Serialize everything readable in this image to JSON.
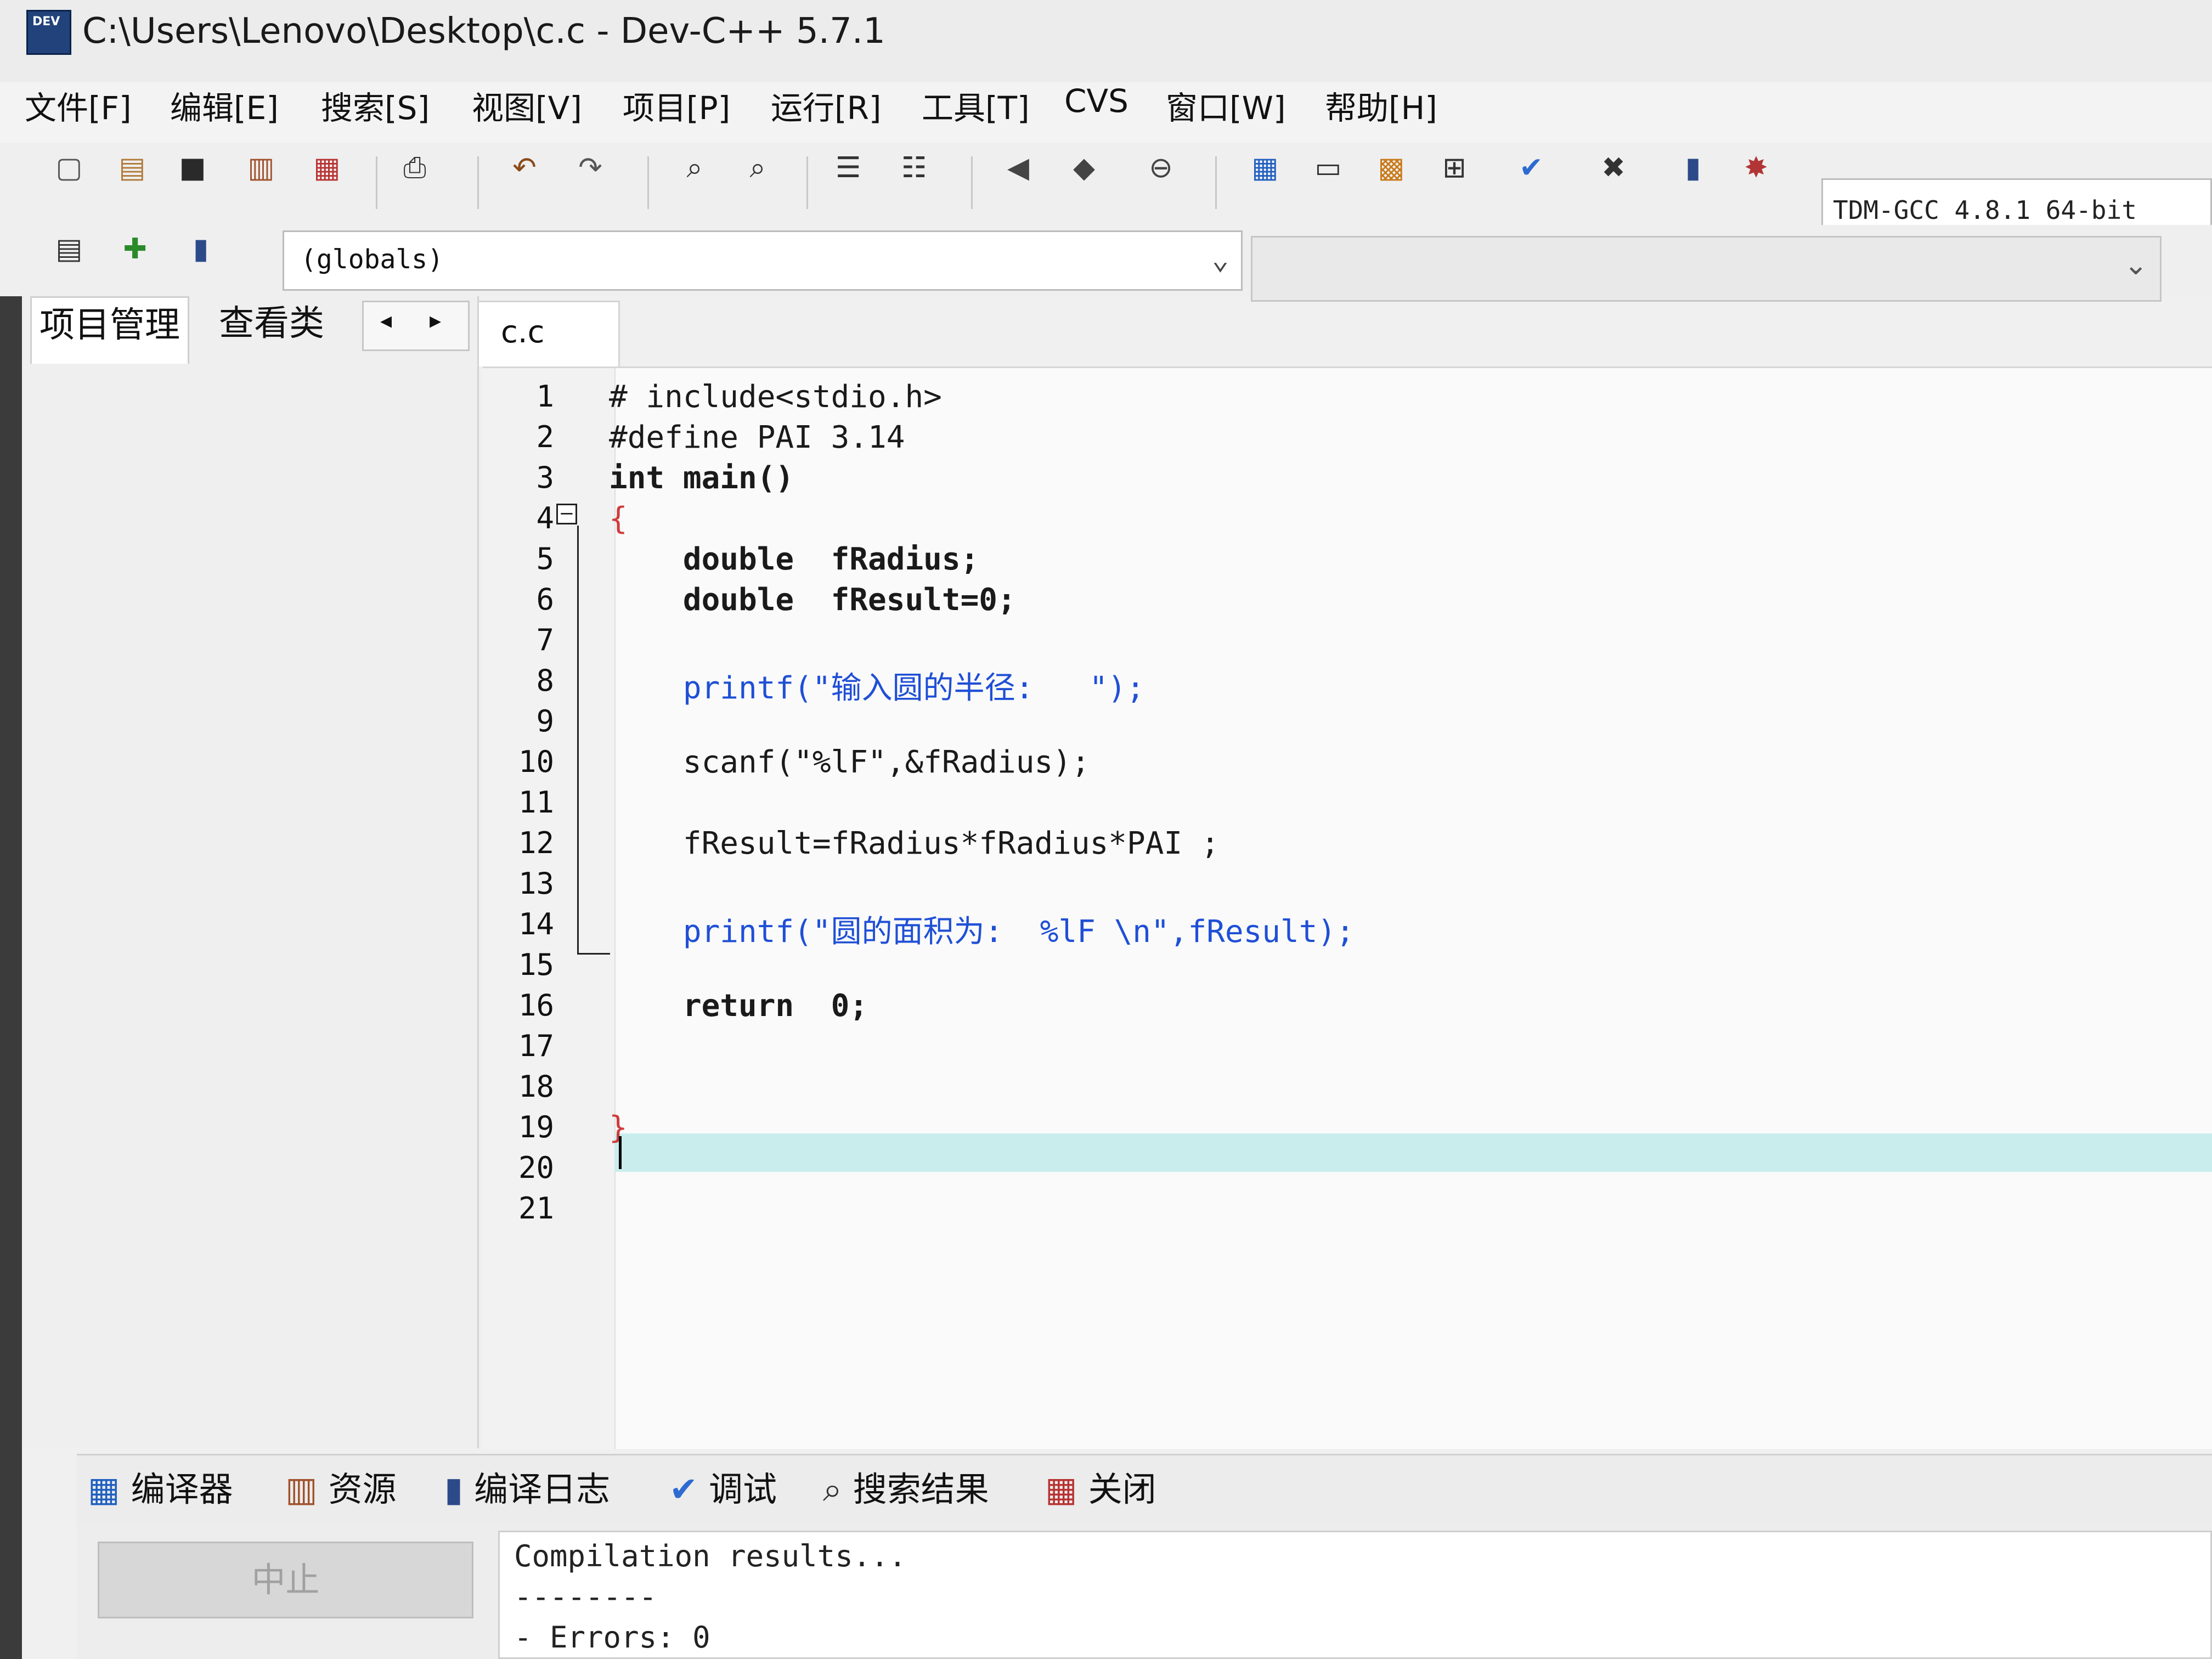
{
  "window": {
    "logo_text": "DEV",
    "title": "C:\\Users\\Lenovo\\Desktop\\c.c - Dev-C++ 5.7.1"
  },
  "menu": [
    "文件[F]",
    "编辑[E]",
    "搜索[S]",
    "视图[V]",
    "项目[P]",
    "运行[R]",
    "工具[T]",
    "CVS",
    "窗口[W]",
    "帮助[H]"
  ],
  "toolbar": {
    "compiler_select": "TDM-GCC 4.8.1 64-bit",
    "scope_select": "(globals)"
  },
  "left_panel": {
    "tab_project": "项目管理",
    "tab_classes": "查看类",
    "nav_prev": "◂",
    "nav_next": "▸"
  },
  "editor": {
    "file_tab": "c.c",
    "line_numbers": [
      "1",
      "2",
      "3",
      "4",
      "5",
      "6",
      "7",
      "8",
      "9",
      "10",
      "11",
      "12",
      "13",
      "14",
      "15",
      "16",
      "17",
      "18",
      "19",
      "20",
      "21"
    ],
    "lines": [
      "# include<stdio.h>",
      "#define PAI 3.14",
      "int main()",
      "{",
      "    double  fRadius;",
      "    double  fResult=0;",
      "",
      "    printf(\"输入圆的半径:   \");",
      "",
      "    scanf(\"%lF\",&fRadius);",
      "",
      "    fResult=fRadius*fRadius*PAI ;",
      "",
      "    printf(\"圆的面积为:  %lF \\n\",fResult);",
      "",
      "    return  0;",
      "",
      "",
      "}",
      "",
      ""
    ]
  },
  "bottom": {
    "tabs": [
      "编译器",
      "资源",
      "编译日志",
      "调试",
      "搜索结果",
      "关闭"
    ],
    "abort_button": "中止",
    "log_lines": [
      "Compilation results...",
      "--------",
      "- Errors: 0"
    ]
  },
  "colors": {
    "keyword": "#1a1a1a",
    "string": "#1f4fd6",
    "punct": "#d13a3a",
    "highlight": "#c9eded"
  }
}
